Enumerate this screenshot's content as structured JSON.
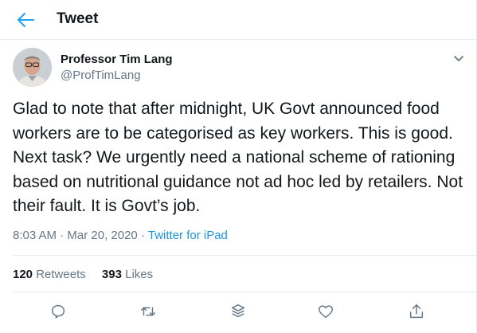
{
  "header": {
    "title": "Tweet",
    "back_icon": "arrow-left-icon"
  },
  "author": {
    "name": "Professor Tim Lang",
    "handle": "@ProfTimLang"
  },
  "tweet": {
    "text": "Glad to note that after midnight, UK Govt announced food workers are to be categorised as key workers. This is good. Next task? We urgently need a national scheme of rationing based on nutritional guidance not ad hoc led by retailers. Not their fault. It is Govt’s job.",
    "time": "8:03 AM",
    "separator": "·",
    "date": "Mar 20, 2020",
    "source": "Twitter for iPad"
  },
  "stats": {
    "retweets_count": "120",
    "retweets_label": "Retweets",
    "likes_count": "393",
    "likes_label": "Likes"
  },
  "actions": [
    "reply-icon",
    "retweet-icon",
    "share-stack-icon",
    "like-icon",
    "share-icon"
  ],
  "colors": {
    "accent": "#1da1f2",
    "link": "#1b95e0",
    "muted": "#657786",
    "text": "#14171a",
    "divider": "#e6ecf0"
  }
}
